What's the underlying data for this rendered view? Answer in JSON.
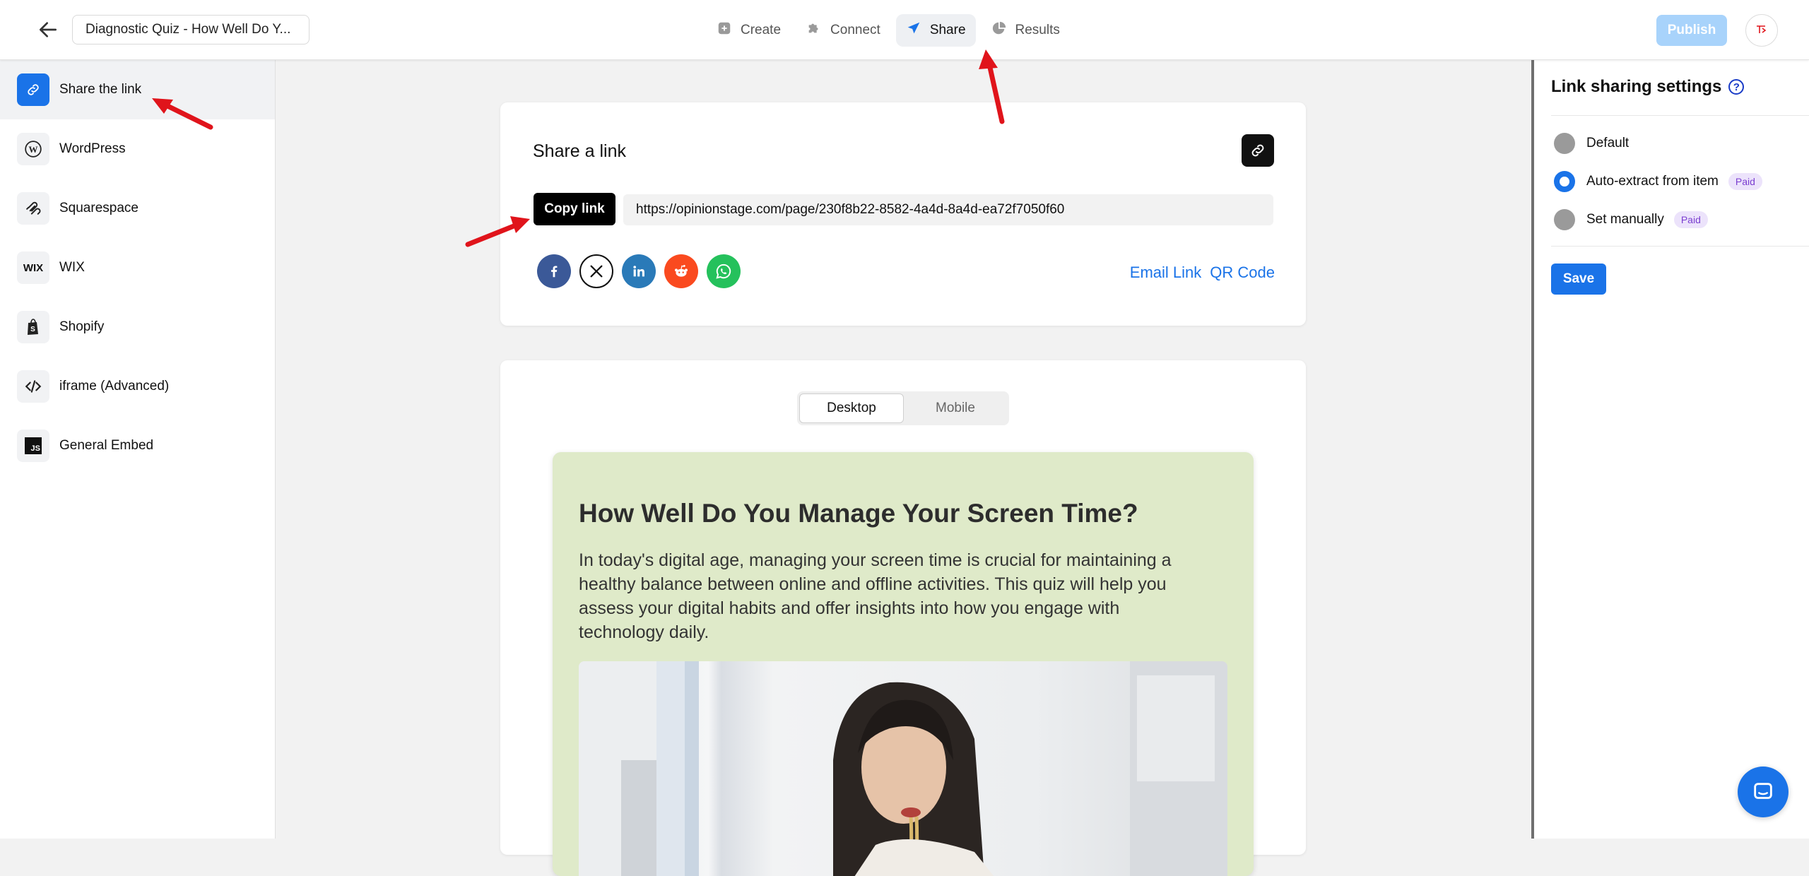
{
  "header": {
    "quiz_title": "Diagnostic Quiz - How Well Do Y...",
    "nav": [
      {
        "label": "Create",
        "icon": "plus-square-icon"
      },
      {
        "label": "Connect",
        "icon": "puzzle-icon"
      },
      {
        "label": "Share",
        "icon": "paper-plane-icon",
        "active": true
      },
      {
        "label": "Results",
        "icon": "pie-chart-icon"
      }
    ],
    "publish_label": "Publish"
  },
  "sidebar": {
    "items": [
      {
        "label": "Share the link",
        "icon": "link-icon",
        "active": true
      },
      {
        "label": "WordPress",
        "icon": "wordpress-icon"
      },
      {
        "label": "Squarespace",
        "icon": "squarespace-icon"
      },
      {
        "label": "WIX",
        "icon": "wix-icon",
        "icon_text": "WIX"
      },
      {
        "label": "Shopify",
        "icon": "shopify-icon"
      },
      {
        "label": "iframe (Advanced)",
        "icon": "code-icon"
      },
      {
        "label": "General Embed",
        "icon": "js-icon",
        "icon_text": "JS"
      }
    ]
  },
  "share": {
    "title": "Share a link",
    "copy_label": "Copy link",
    "url": "https://opinionstage.com/page/230f8b22-8582-4a4d-8a4d-ea72f7050f60",
    "social": [
      "facebook-icon",
      "x-icon",
      "linkedin-icon",
      "reddit-icon",
      "whatsapp-icon"
    ],
    "email_link": "Email Link",
    "qr_code": "QR Code"
  },
  "preview": {
    "tabs": [
      {
        "label": "Desktop",
        "active": true
      },
      {
        "label": "Mobile"
      }
    ],
    "quiz_title": "How Well Do You Manage Your Screen Time?",
    "quiz_description": "In today's digital age, managing your screen time is crucial for maintaining a healthy balance between online and offline activities. This quiz will help you assess your digital habits and offer insights into how you engage with technology daily."
  },
  "link_settings": {
    "title": "Link sharing settings",
    "options": [
      {
        "label": "Default",
        "checked": false
      },
      {
        "label": "Auto-extract from item",
        "checked": true,
        "badge": "Paid"
      },
      {
        "label": "Set manually",
        "checked": false,
        "badge": "Paid"
      }
    ],
    "save_label": "Save"
  },
  "colors": {
    "accent": "#1a73e8",
    "preview_bg": "#dfeac9",
    "paid_badge_bg": "#ece3fb",
    "paid_badge_text": "#7b3fd1",
    "annotation_arrow": "#e0141b"
  }
}
